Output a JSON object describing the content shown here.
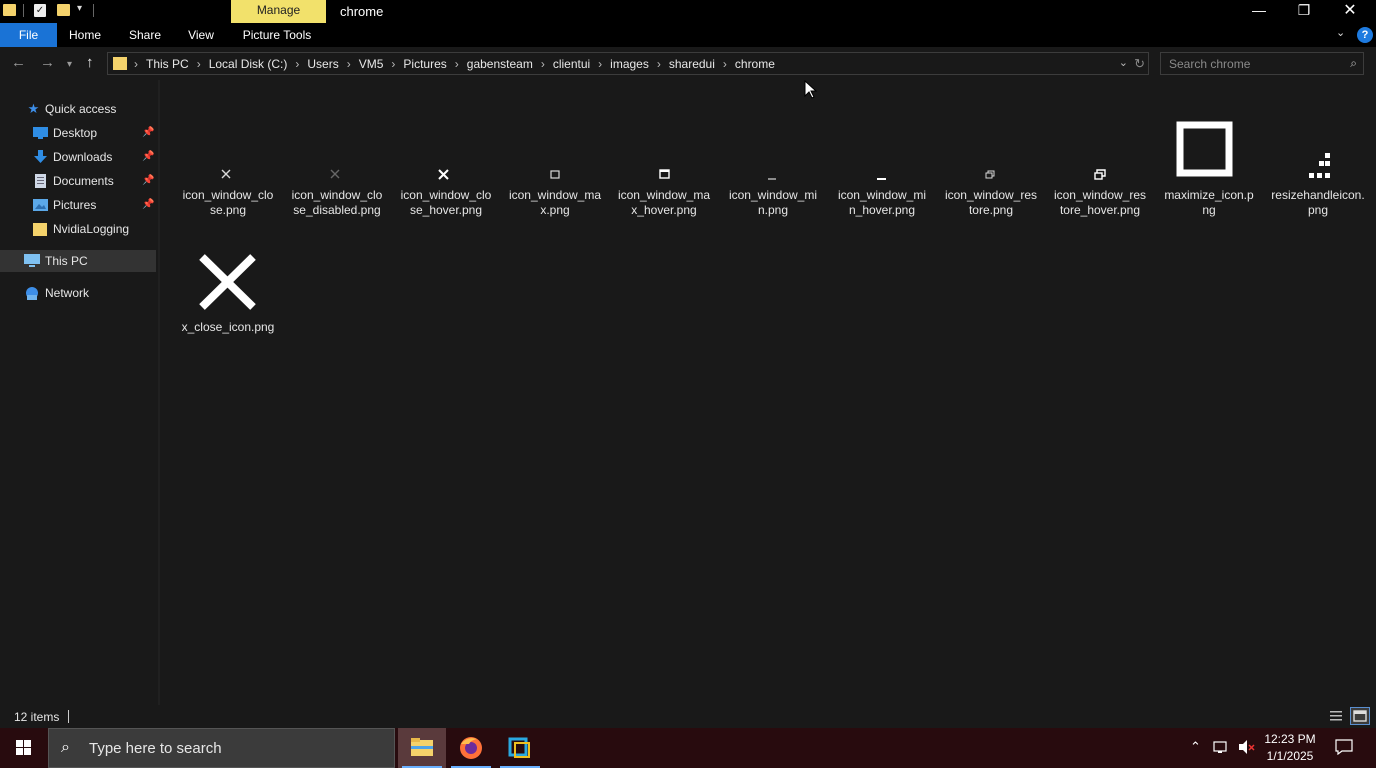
{
  "window": {
    "title": "chrome",
    "contextual_tab_group": "Manage"
  },
  "ribbon": {
    "tabs": [
      "File",
      "Home",
      "Share",
      "View",
      "Picture Tools"
    ]
  },
  "navigation": {
    "breadcrumb": [
      "This PC",
      "Local Disk (C:)",
      "Users",
      "VM5",
      "Pictures",
      "gabensteam",
      "clientui",
      "images",
      "sharedui",
      "chrome"
    ],
    "search_placeholder": "Search chrome"
  },
  "nav_pane": {
    "quick_access": "Quick access",
    "items": [
      {
        "label": "Desktop",
        "icon": "desktop-icon",
        "pinned": true
      },
      {
        "label": "Downloads",
        "icon": "download-icon",
        "pinned": true
      },
      {
        "label": "Documents",
        "icon": "document-icon",
        "pinned": true
      },
      {
        "label": "Pictures",
        "icon": "pictures-icon",
        "pinned": true
      },
      {
        "label": "NvidiaLogging",
        "icon": "folder-icon",
        "pinned": false
      }
    ],
    "this_pc": "This PC",
    "network": "Network",
    "selected": "This PC"
  },
  "files": [
    {
      "name": "icon_window_close.png",
      "display": "icon_window_clo\nse.png",
      "preview": "close-small-icon"
    },
    {
      "name": "icon_window_close_disabled.png",
      "display": "icon_window_clo\nse_disabled.png",
      "preview": "close-disabled-icon"
    },
    {
      "name": "icon_window_close_hover.png",
      "display": "icon_window_clo\nse_hover.png",
      "preview": "close-hover-icon"
    },
    {
      "name": "icon_window_max.png",
      "display": "icon_window_ma\nx.png",
      "preview": "maximize-small-icon"
    },
    {
      "name": "icon_window_max_hover.png",
      "display": "icon_window_ma\nx_hover.png",
      "preview": "maximize-hover-icon"
    },
    {
      "name": "icon_window_min.png",
      "display": "icon_window_mi\nn.png",
      "preview": "minimize-small-icon"
    },
    {
      "name": "icon_window_min_hover.png",
      "display": "icon_window_mi\nn_hover.png",
      "preview": "minimize-hover-icon"
    },
    {
      "name": "icon_window_restore.png",
      "display": "icon_window_res\ntore.png",
      "preview": "restore-small-icon"
    },
    {
      "name": "icon_window_restore_hover.png",
      "display": "icon_window_res\ntore_hover.png",
      "preview": "restore-hover-icon"
    },
    {
      "name": "maximize_icon.png",
      "display": "maximize_icon.p\nng",
      "preview": "maximize-large-icon"
    },
    {
      "name": "resizehandleicon.png",
      "display": "resizehandleicon.\npng",
      "preview": "resize-handle-icon"
    },
    {
      "name": "x_close_icon.png",
      "display": "x_close_icon.png",
      "preview": "close-large-icon"
    }
  ],
  "status": {
    "item_count": "12 items"
  },
  "taskbar": {
    "search_placeholder": "Type here to search",
    "apps": [
      "file-explorer-icon",
      "firefox-icon",
      "virtualbox-icon"
    ],
    "time": "12:23 PM",
    "date": "1/1/2025"
  },
  "colors": {
    "accent": "#1a73d6",
    "manage_tab": "#f2e16b",
    "taskbar": "#280b0e",
    "background": "#191919"
  }
}
